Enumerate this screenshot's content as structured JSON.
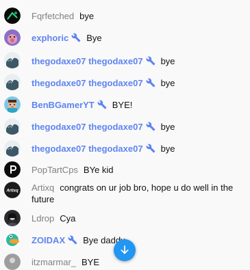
{
  "messages": [
    {
      "author": "Fqrfetched",
      "text": "bye",
      "moderator": false,
      "avatar_icon": "avatar-black-green"
    },
    {
      "author": "exphoric",
      "text": "Bye",
      "moderator": true,
      "avatar_icon": "avatar-purple-pig"
    },
    {
      "author": "thegodaxe07 thegodaxe07",
      "text": "bye",
      "moderator": true,
      "avatar_icon": "avatar-waves"
    },
    {
      "author": "thegodaxe07 thegodaxe07",
      "text": "bye",
      "moderator": true,
      "avatar_icon": "avatar-waves"
    },
    {
      "author": "BenBGamerYT",
      "text": "BYE!",
      "moderator": true,
      "avatar_icon": "avatar-minecraft"
    },
    {
      "author": "thegodaxe07 thegodaxe07",
      "text": "bye",
      "moderator": true,
      "avatar_icon": "avatar-waves"
    },
    {
      "author": "thegodaxe07 thegodaxe07",
      "text": "bye",
      "moderator": true,
      "avatar_icon": "avatar-waves"
    },
    {
      "author": "PopTartCps",
      "text": "BYe kid",
      "moderator": false,
      "avatar_icon": "avatar-black-p"
    },
    {
      "author": "Artixq",
      "text": "congrats on ur job bro, hope u do well in the future",
      "moderator": false,
      "avatar_icon": "avatar-artixq"
    },
    {
      "author": "Ldrop",
      "text": "Cya",
      "moderator": false,
      "avatar_icon": "avatar-dark-person"
    },
    {
      "author": "ZOIDAX",
      "text": "Bye daddy",
      "moderator": true,
      "avatar_icon": "avatar-platypus"
    },
    {
      "author": "itzmarmar_",
      "text": "BYE",
      "moderator": false,
      "avatar_icon": "avatar-gray"
    }
  ],
  "avatar_labels": {
    "artixq": "Artixq"
  },
  "scroll_button": {
    "icon": "arrow-down-icon"
  },
  "colors": {
    "moderator_name": "#5e84f1",
    "author_name": "#808080",
    "scroll_button": "#2196f3",
    "background": "#f9f9f9"
  }
}
